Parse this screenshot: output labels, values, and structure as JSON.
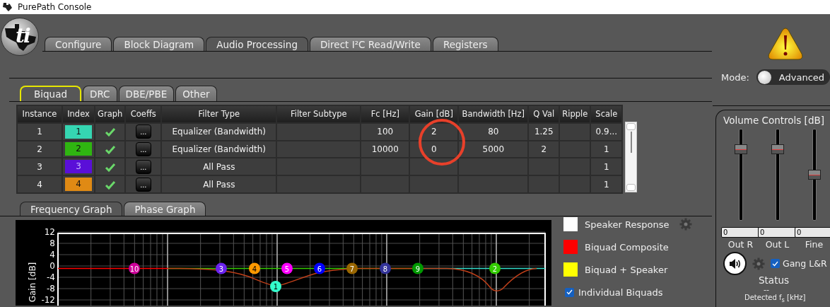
{
  "window": {
    "title": "PurePath Console"
  },
  "logo": {
    "text": "ti"
  },
  "main_tabs": [
    {
      "label": "Configure",
      "selected": false
    },
    {
      "label": "Block Diagram",
      "selected": false
    },
    {
      "label": "Audio Processing",
      "selected": true
    },
    {
      "label": "Direct I²C Read/Write",
      "selected": false
    },
    {
      "label": "Registers",
      "selected": false
    }
  ],
  "mode": {
    "label": "Mode:",
    "value": "Advanced"
  },
  "sub_tabs": [
    {
      "label": "Biquad",
      "selected": true
    },
    {
      "label": "DRC",
      "selected": false
    },
    {
      "label": "DBE/PBE",
      "selected": false
    },
    {
      "label": "Other",
      "selected": false
    }
  ],
  "table": {
    "columns": [
      "Instance",
      "Index",
      "Graph",
      "Coeffs",
      "Filter Type",
      "Filter Subtype",
      "Fc [Hz]",
      "Gain [dB]",
      "Bandwidth [Hz]",
      "Q Val",
      "Ripple",
      "Scale"
    ],
    "rows": [
      {
        "instance": "1",
        "index": "1",
        "color": "#35d6b2",
        "graph": true,
        "coeffs": "...",
        "filter_type": "Equalizer (Bandwidth)",
        "fc": "100",
        "gain": "2",
        "bandwidth": "80",
        "q_val": "1.25",
        "scale": "0.9..."
      },
      {
        "instance": "2",
        "index": "2",
        "color": "#2fb511",
        "graph": true,
        "coeffs": "...",
        "filter_type": "Equalizer (Bandwidth)",
        "fc": "10000",
        "gain": "0",
        "bandwidth": "5000",
        "q_val": "2",
        "scale": "1"
      },
      {
        "instance": "3",
        "index": "3",
        "color": "#5a0fd8",
        "graph": true,
        "coeffs": "...",
        "filter_type": "All Pass",
        "scale": "1"
      },
      {
        "instance": "4",
        "index": "4",
        "color": "#e08a14",
        "graph": true,
        "coeffs": "...",
        "filter_type": "All Pass",
        "scale": "1"
      }
    ]
  },
  "graph_tabs": [
    {
      "label": "Frequency Graph",
      "selected": true
    },
    {
      "label": "Phase Graph",
      "selected": false
    }
  ],
  "graph": {
    "ylabel": "Gain [dB]",
    "y_tick_labels": [
      "12",
      "8",
      "4",
      "0",
      "-4",
      "-8",
      "-12"
    ],
    "markers": [
      {
        "label": "10",
        "color": "#cc0099"
      },
      {
        "label": "3",
        "color": "#6a22ee"
      },
      {
        "label": "4",
        "color": "#ff9900"
      },
      {
        "label": "1",
        "color": "#33ffcc"
      },
      {
        "label": "5",
        "color": "#ff00ff"
      },
      {
        "label": "6",
        "color": "#0000ff"
      },
      {
        "label": "7",
        "color": "#996600"
      },
      {
        "label": "8",
        "color": "#333399"
      },
      {
        "label": "9",
        "color": "#009900"
      },
      {
        "label": "2",
        "color": "#33cc00"
      }
    ]
  },
  "legend": [
    {
      "kind": "swatch",
      "label": "Speaker Response",
      "color": "#ffffff",
      "has_settings": true
    },
    {
      "kind": "swatch",
      "label": "Biquad Composite",
      "color": "#ff0000",
      "has_settings": false
    },
    {
      "kind": "swatch",
      "label": "Biquad + Speaker",
      "color": "#ffff00",
      "has_settings": false
    },
    {
      "kind": "checkbox",
      "label": "Individual Biquads",
      "checked": true
    }
  ],
  "volume": {
    "title": "Volume Controls [dB]",
    "sliders": [
      {
        "label": "Out R",
        "value": "0",
        "level": 0.82
      },
      {
        "label": "Out L",
        "value": "0",
        "level": 0.82
      },
      {
        "label": "Fine",
        "value": "0",
        "level": 0.5
      }
    ],
    "gang": {
      "label": "Gang L&R",
      "checked": true
    },
    "status": {
      "label": "Status",
      "value": "--"
    },
    "detected_label": "Detected f$_{s}$ [kHz]"
  }
}
